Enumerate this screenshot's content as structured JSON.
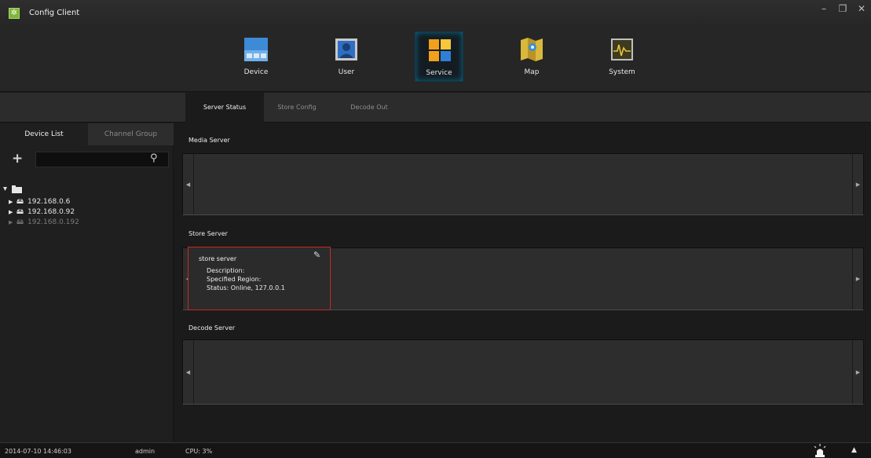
{
  "window": {
    "title": "Config Client",
    "icon": "gear-icon",
    "minimize_label": "–",
    "restore_label": "❐",
    "close_label": "✕"
  },
  "nav": {
    "items": [
      {
        "label": "Device",
        "icon": "device-icon",
        "active": false
      },
      {
        "label": "User",
        "icon": "user-icon",
        "active": false
      },
      {
        "label": "Service",
        "icon": "service-icon",
        "active": true
      },
      {
        "label": "Map",
        "icon": "map-icon",
        "active": false
      },
      {
        "label": "System",
        "icon": "system-icon",
        "active": false
      }
    ]
  },
  "subtabs": [
    {
      "label": "Server Status",
      "active": true
    },
    {
      "label": "Store Config",
      "active": false
    },
    {
      "label": "Decode Out",
      "active": false
    }
  ],
  "sidebar": {
    "tabs": [
      {
        "label": "Device List",
        "active": true
      },
      {
        "label": "Channel Group",
        "active": false
      }
    ],
    "search": {
      "value": "",
      "placeholder": ""
    },
    "tree": [
      {
        "label": "192.168.0.6",
        "online": true
      },
      {
        "label": "192.168.0.92",
        "online": true
      },
      {
        "label": "192.168.0.192",
        "online": false
      }
    ]
  },
  "sections": {
    "media": {
      "title": "Media Server"
    },
    "store": {
      "title": "Store Server",
      "card": {
        "name": "store server",
        "description": "Description:",
        "region": "Specified Region:",
        "status": "Status: Online, 127.0.0.1"
      }
    },
    "decode": {
      "title": "Decode Server"
    }
  },
  "status": {
    "datetime": "2014-07-10 14:46:03",
    "user": "admin",
    "cpu": "CPU: 3%"
  },
  "colors": {
    "accent_active": "#0a6e8f",
    "selection_border": "#c72828",
    "app_icon": "#7fb539"
  }
}
